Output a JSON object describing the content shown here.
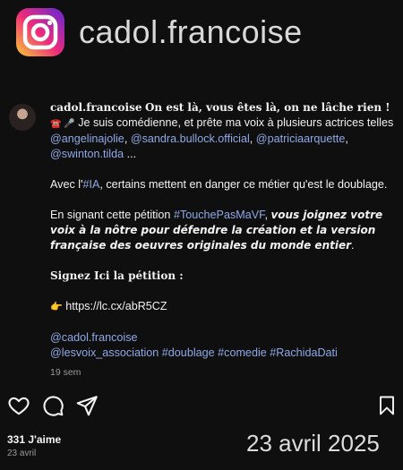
{
  "header": {
    "logo_icon": "instagram-icon",
    "username": "cadol.francoise"
  },
  "post": {
    "author": "cadol.francoise",
    "headline": "On est là, vous êtes là, on ne lâche rien !",
    "line1_icons": "☎️ 🎤",
    "line1_text": "Je suis comédienne, et prête ma voix à plusieurs actrices telles",
    "mention_1": "@angelinajolie",
    "mention_2": "@sandra.bullock.official",
    "mention_3": "@patriciaarquette",
    "mention_4": "@swinton.tilda",
    "ellipsis": "...",
    "para2_before": "Avec l'",
    "para2_hashtag": "#IA",
    "para2_after": ", certains mettent en danger ce métier qu'est le doublage.",
    "para3_before": "En signant cette pétition",
    "para3_hashtag": "#TouchePasMaVF",
    "para3_bold": "vous joignez votre voix à la nôtre pour défendre la création et la version française des oeuvres originales du monde entier",
    "para3_end": ".",
    "sign_label": "Signez Ici la pétition :",
    "link_icon": "👉",
    "link": "https://lc.cx/abR5CZ",
    "tag_author": "@cadol.francoise",
    "tag_assoc": "@lesvoix_association",
    "hashtag_1": "#doublage",
    "hashtag_2": "#comedie",
    "hashtag_3": "#RachidaDati",
    "time": "19 sem"
  },
  "actions": {
    "like_icon": "heart-icon",
    "comment_icon": "comment-icon",
    "share_icon": "send-icon",
    "save_icon": "bookmark-icon"
  },
  "footer": {
    "likes": "331 J'aime",
    "date_small": "23 avril",
    "date_big": "23 avril 2025"
  }
}
